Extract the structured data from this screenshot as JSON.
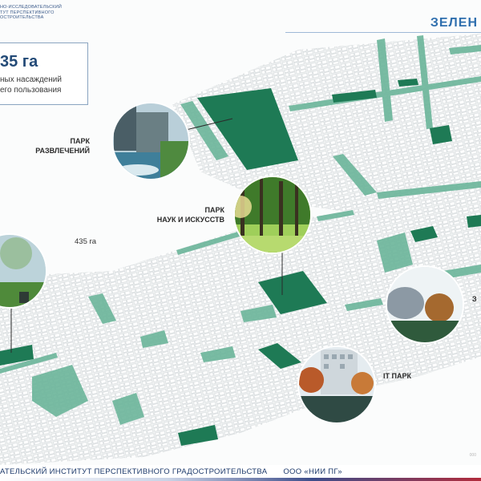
{
  "header": {
    "org_lines": [
      "НО-ИССЛЕДОВАТЕЛЬСКИЙ",
      "ТУТ ПЕРСПЕКТИВНОГО",
      "ОСТРОИТЕЛЬСТВА"
    ],
    "title": "ЗЕЛЕН"
  },
  "stat": {
    "value": "35 га",
    "line1": "ных насаждений",
    "line2": "его пользования"
  },
  "parks": [
    {
      "label_line1": "ПАРК",
      "label_line2": "РАЗВЛЕЧЕНИЙ"
    },
    {
      "label_line1": "ПАРК",
      "label_line2": "НАУК И ИСКУССТВ"
    },
    {
      "label_line1": "IT ПАРК",
      "label_line2": ""
    },
    {
      "label_line1": "З",
      "label_line2": ""
    }
  ],
  "area_label": "435 га",
  "footer": {
    "institute": "АТЕЛЬСКИЙ ИНСТИТУТ ПЕРСПЕКТИВНОГО ГРАДОСТРОИТЕЛЬСТВА",
    "company": "ООО «НИИ ПГ»"
  },
  "page_number": "000",
  "colors": {
    "park_fill": "#1e7a55",
    "greenway": "#6bb59a",
    "accent_blue": "#2f6fae",
    "footer_red": "#b22c3c"
  }
}
